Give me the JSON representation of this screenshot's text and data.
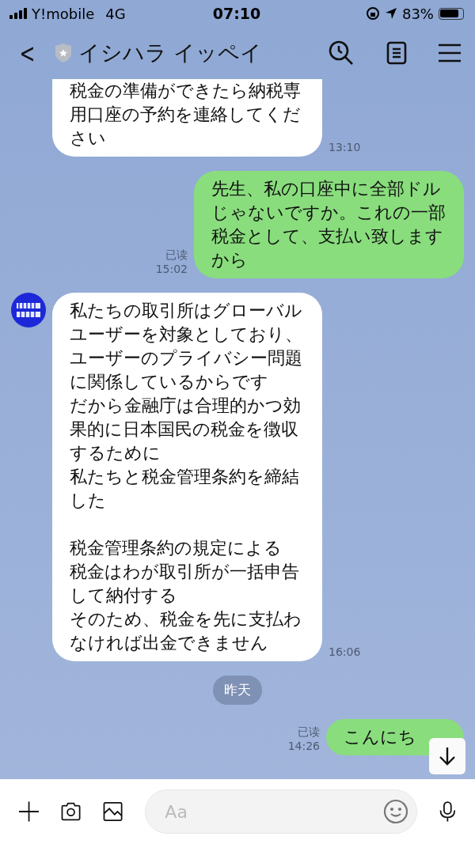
{
  "status_bar": {
    "carrier": "Y!mobile",
    "network": "4G",
    "time": "07:10",
    "battery": "83%"
  },
  "header": {
    "back": "<",
    "title": "イシハラ イッペイ"
  },
  "messages": [
    {
      "kind": "incoming",
      "avatar": false,
      "paragraphs": [
        [
          "税金の準備ができたら納税専用口座の予約を連絡してください"
        ]
      ],
      "time": "13:10"
    },
    {
      "kind": "outgoing",
      "read": "已读",
      "paragraphs": [
        [
          "先生、私の口座中に全部ドルじゃないですか。これの一部税金として、支払い致しますから"
        ]
      ],
      "time": "15:02"
    },
    {
      "kind": "incoming",
      "avatar": true,
      "paragraphs": [
        [
          "私たちの取引所はグローバルユーザーを対象としており、ユーザーのプライバシー問題に関係しているからです",
          "だから金融庁は合理的かつ効果的に日本国民の税金を徴収するために",
          "私たちと税金管理条約を締結した"
        ],
        [
          "税金管理条約の規定による",
          "税金はわが取引所が一括申告して納付する",
          "そのため、税金を先に支払わなければ出金できません"
        ]
      ],
      "time": "16:06"
    },
    {
      "kind": "date",
      "text": "昨天"
    },
    {
      "kind": "outgoing",
      "read": "已读",
      "paragraphs": [
        [
          "こんにち"
        ]
      ],
      "time": "14:26"
    }
  ],
  "input": {
    "placeholder": "Aa"
  }
}
